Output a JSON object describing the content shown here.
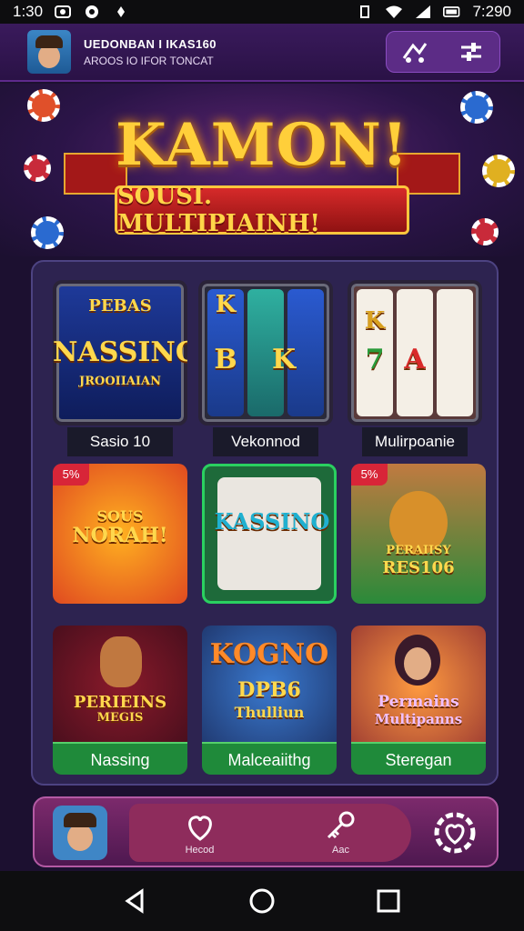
{
  "status_bar": {
    "time_left": "1:30",
    "time_right": "7:290",
    "icons": [
      "notification-icon",
      "app-icon",
      "signal-icon",
      "wifi-icon",
      "battery-icon"
    ]
  },
  "header": {
    "title": "UEDONBAN I IKAS160",
    "subtitle": "AROOS IO IFOR TONCAT",
    "icons": [
      "transfer-icon",
      "filter-icon"
    ]
  },
  "banner": {
    "title": "KAMON!",
    "ribbon_text": "SOUSI. MULTIPIAINH!"
  },
  "games": [
    {
      "label": "Sasio 10",
      "art_lines": [
        "PEBAS",
        "NASSINO",
        "JROOIIAIAN"
      ]
    },
    {
      "label": "Vekonnod",
      "art_lines": [
        "K",
        "B",
        "K"
      ]
    },
    {
      "label": "Mulirpoanie",
      "art_lines": [
        "K",
        "7",
        "A"
      ]
    },
    {
      "badge": "5%",
      "label": "",
      "art_lines": [
        "SOUS",
        "NORAH!"
      ]
    },
    {
      "label": "",
      "art_lines": [
        "KASSINO"
      ]
    },
    {
      "badge": "5%",
      "label": "",
      "art_lines": [
        "PERAIISY",
        "RES106"
      ]
    },
    {
      "label": "Nassing",
      "art_lines": [
        "PERIEINS",
        "MEGIS"
      ]
    },
    {
      "label": "Malceaiithg",
      "art_lines": [
        "KOGNO",
        "DPB6",
        "Thulliun"
      ]
    },
    {
      "label": "Steregan",
      "art_lines": [
        "Permains",
        "Multipanns"
      ]
    }
  ],
  "bottom_bar": {
    "nav": [
      {
        "label": "Hecod",
        "icon": "heart-chat-icon"
      },
      {
        "label": "Aac",
        "icon": "key-icon"
      }
    ],
    "settings_icon": "heart-gear-icon"
  },
  "system_nav": [
    "back-icon",
    "home-icon",
    "recents-icon"
  ],
  "colors": {
    "accent": "#ffcf3a",
    "header_bg": "#2a1246",
    "panel_bg": "#2d2350",
    "green_label": "#1f8a3a"
  }
}
